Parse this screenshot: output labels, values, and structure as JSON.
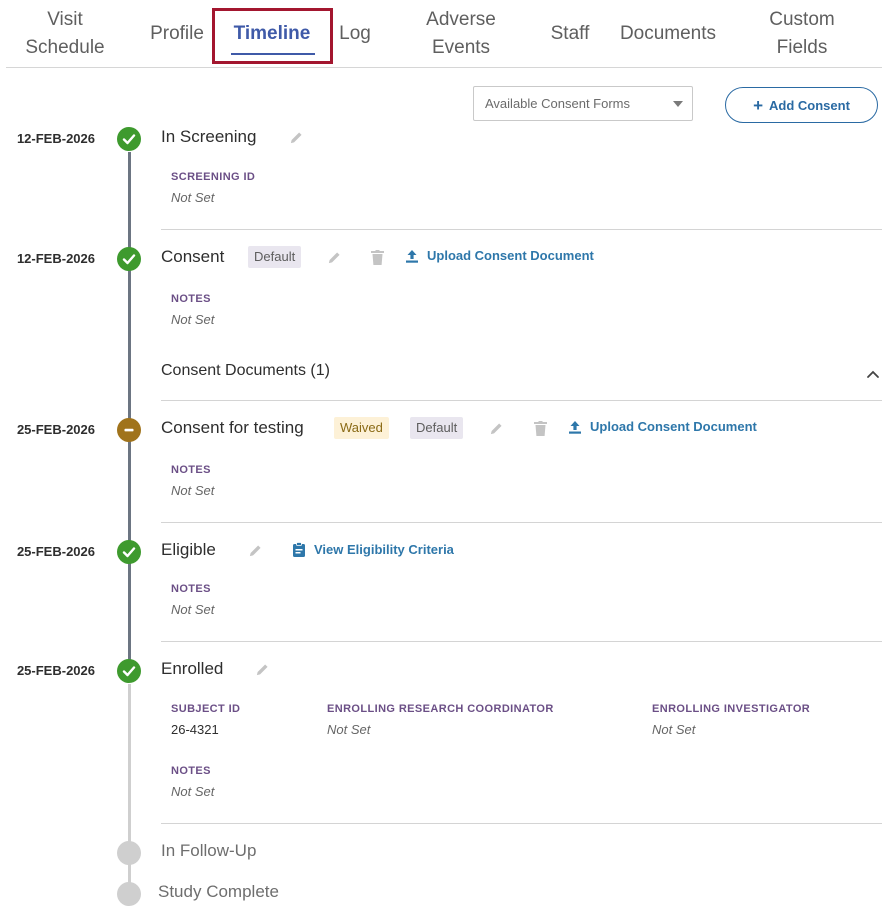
{
  "tabs": [
    {
      "label": "Visit\nSchedule"
    },
    {
      "label": "Profile"
    },
    {
      "label": "Timeline"
    },
    {
      "label": "Log"
    },
    {
      "label": "Adverse\nEvents"
    },
    {
      "label": "Staff"
    },
    {
      "label": "Documents"
    },
    {
      "label": "Custom\nFields"
    }
  ],
  "active_tab": "Timeline",
  "consent_select": {
    "placeholder": "Available Consent Forms"
  },
  "add_consent_label": "Add Consent",
  "timeline": {
    "screening": {
      "date": "12-FEB-2026",
      "title": "In Screening",
      "field_label": "SCREENING ID",
      "field_value": "Not Set"
    },
    "consent": {
      "date": "12-FEB-2026",
      "title": "Consent",
      "badge": "Default",
      "upload_label": "Upload Consent Document",
      "field_label": "NOTES",
      "field_value": "Not Set"
    },
    "consent_documents": {
      "title": "Consent Documents (1)"
    },
    "consent_testing": {
      "date": "25-FEB-2026",
      "title": "Consent for testing",
      "badge_waived": "Waived",
      "badge_default": "Default",
      "upload_label": "Upload Consent Document",
      "field_label": "NOTES",
      "field_value": "Not Set"
    },
    "eligible": {
      "date": "25-FEB-2026",
      "title": "Eligible",
      "link_label": "View Eligibility Criteria",
      "field_label": "NOTES",
      "field_value": "Not Set"
    },
    "enrolled": {
      "date": "25-FEB-2026",
      "title": "Enrolled",
      "subject_id_label": "SUBJECT ID",
      "subject_id_value": "26-4321",
      "coordinator_label": "ENROLLING RESEARCH COORDINATOR",
      "coordinator_value": "Not Set",
      "investigator_label": "ENROLLING INVESTIGATOR",
      "investigator_value": "Not Set",
      "notes_label": "NOTES",
      "notes_value": "Not Set"
    },
    "follow_up": {
      "title": "In Follow-Up"
    },
    "study_complete": {
      "title": "Study Complete"
    }
  },
  "colors": {
    "accent": "#3f5aa8",
    "highlight_border": "#a3162f",
    "done": "#3e9a2e",
    "waived": "#a0731b",
    "pending": "#cfcfcf",
    "link": "#2e77aa",
    "label": "#6b4f86"
  },
  "icons": [
    "check-icon",
    "minus-icon",
    "pencil-icon",
    "trash-icon",
    "upload-icon",
    "clipboard-icon",
    "plus-icon",
    "chevron-up-icon",
    "caret-down-icon"
  ]
}
